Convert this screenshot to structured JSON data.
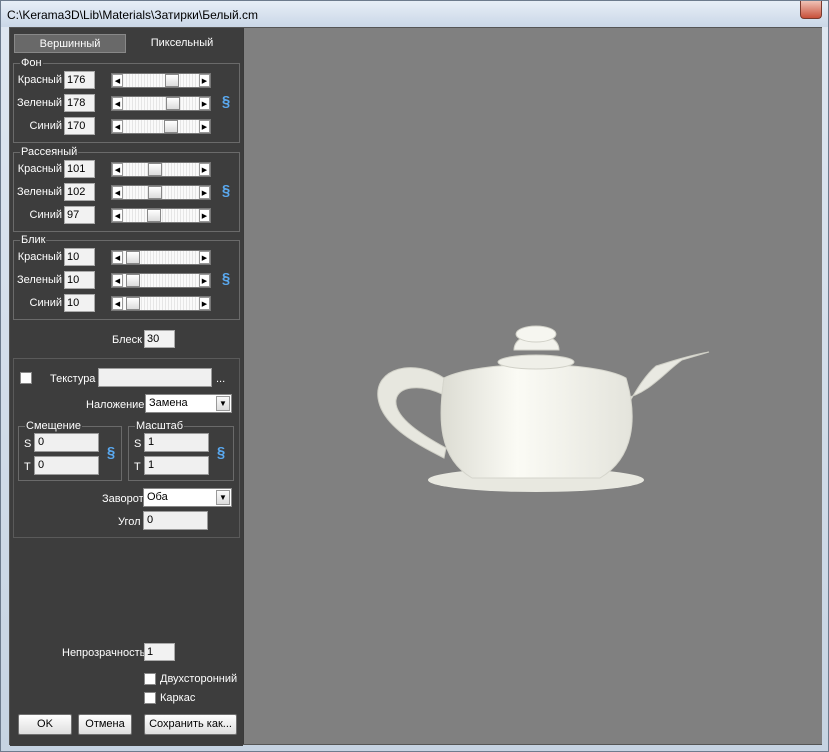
{
  "window": {
    "title": "C:\\Kerama3D\\Lib\\Materials\\Затирки\\Белый.cm"
  },
  "tabs": [
    "Вершинный",
    "Пиксельный"
  ],
  "background": {
    "label": "Фон",
    "rows": [
      {
        "label": "Красный",
        "value": "176",
        "level": 0.69
      },
      {
        "label": "Зеленый",
        "value": "178",
        "level": 0.7
      },
      {
        "label": "Синий",
        "value": "170",
        "level": 0.67
      }
    ]
  },
  "diffuse": {
    "label": "Рассеяный",
    "rows": [
      {
        "label": "Красный",
        "value": "101",
        "level": 0.4
      },
      {
        "label": "Зеленый",
        "value": "102",
        "level": 0.4
      },
      {
        "label": "Синий",
        "value": "97",
        "level": 0.38
      }
    ]
  },
  "specular": {
    "label": "Блик",
    "rows": [
      {
        "label": "Красный",
        "value": "10",
        "level": 0.04
      },
      {
        "label": "Зеленый",
        "value": "10",
        "level": 0.04
      },
      {
        "label": "Синий",
        "value": "10",
        "level": 0.04
      }
    ]
  },
  "shine": {
    "label": "Блеск",
    "value": "30"
  },
  "texture": {
    "label": "Текстура",
    "value": "",
    "browse": "...",
    "blend_label": "Наложение",
    "blend_value": "Замена",
    "offset": {
      "label": "Смещение",
      "s_label": "S",
      "s_value": "0",
      "t_label": "T",
      "t_value": "0"
    },
    "scale": {
      "label": "Масштаб",
      "s_label": "S",
      "s_value": "1",
      "t_label": "T",
      "t_value": "1"
    },
    "wrap_label": "Заворот",
    "wrap_value": "Оба",
    "angle_label": "Угол",
    "angle_value": "0"
  },
  "opacity": {
    "label": "Непрозрачность",
    "value": "1"
  },
  "two_sided": {
    "label": "Двухсторонний"
  },
  "wireframe": {
    "label": "Каркас"
  },
  "buttons": {
    "ok": "OK",
    "cancel": "Отмена",
    "save_as": "Сохранить как..."
  },
  "colors": {
    "viewport": "#808080",
    "panel": "#3d3d3d",
    "link": "#5aa9f0"
  }
}
